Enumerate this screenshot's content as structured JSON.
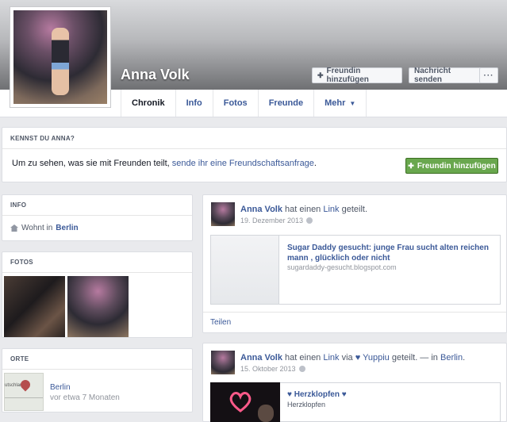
{
  "profile": {
    "name": "Anna Volk"
  },
  "cover_actions": {
    "add_friend": "Freundin hinzufügen",
    "message": "Nachricht senden",
    "more": "···"
  },
  "nav": {
    "tabs": [
      {
        "label": "Chronik"
      },
      {
        "label": "Info"
      },
      {
        "label": "Fotos"
      },
      {
        "label": "Freunde"
      },
      {
        "label": "Mehr"
      }
    ]
  },
  "know_box": {
    "heading": "KENNST DU ANNA?",
    "text_plain": "Um zu sehen, was sie mit Freunden teilt, ",
    "text_link": "sende ihr eine Freundschaftsanfrage",
    "text_end": ".",
    "button": "Freundin hinzufügen"
  },
  "info": {
    "heading": "INFO",
    "lives_prefix": "Wohnt in",
    "lives_city": "Berlin"
  },
  "photos": {
    "heading": "FOTOS"
  },
  "places": {
    "heading": "ORTE",
    "map_label": "utschland",
    "place": "Berlin",
    "time": "vor etwa 7 Monaten"
  },
  "posts": [
    {
      "author": "Anna Volk",
      "verb1": " hat einen ",
      "link_word": "Link",
      "verb2": " geteilt.",
      "date": "19. Dezember 2013",
      "link_title": "Sugar Daddy gesucht: junge Frau sucht alten reichen mann , glücklich oder nicht",
      "link_domain": "sugardaddy-gesucht.blogspot.com",
      "share": "Teilen"
    },
    {
      "author": "Anna Volk",
      "verb1": " hat einen ",
      "link_word": "Link",
      "via": " via ",
      "via_page": "♥ Yuppiu",
      "verb2": " geteilt. — in ",
      "place": "Berlin",
      "end": ".",
      "date": "15. Oktober 2013",
      "media_title": "♥ Herzklopfen ♥",
      "media_sub": "Herzklopfen"
    }
  ],
  "colors": {
    "link": "#3b5998",
    "green_button": "#69a74e",
    "page_bg": "#e9eaed"
  }
}
